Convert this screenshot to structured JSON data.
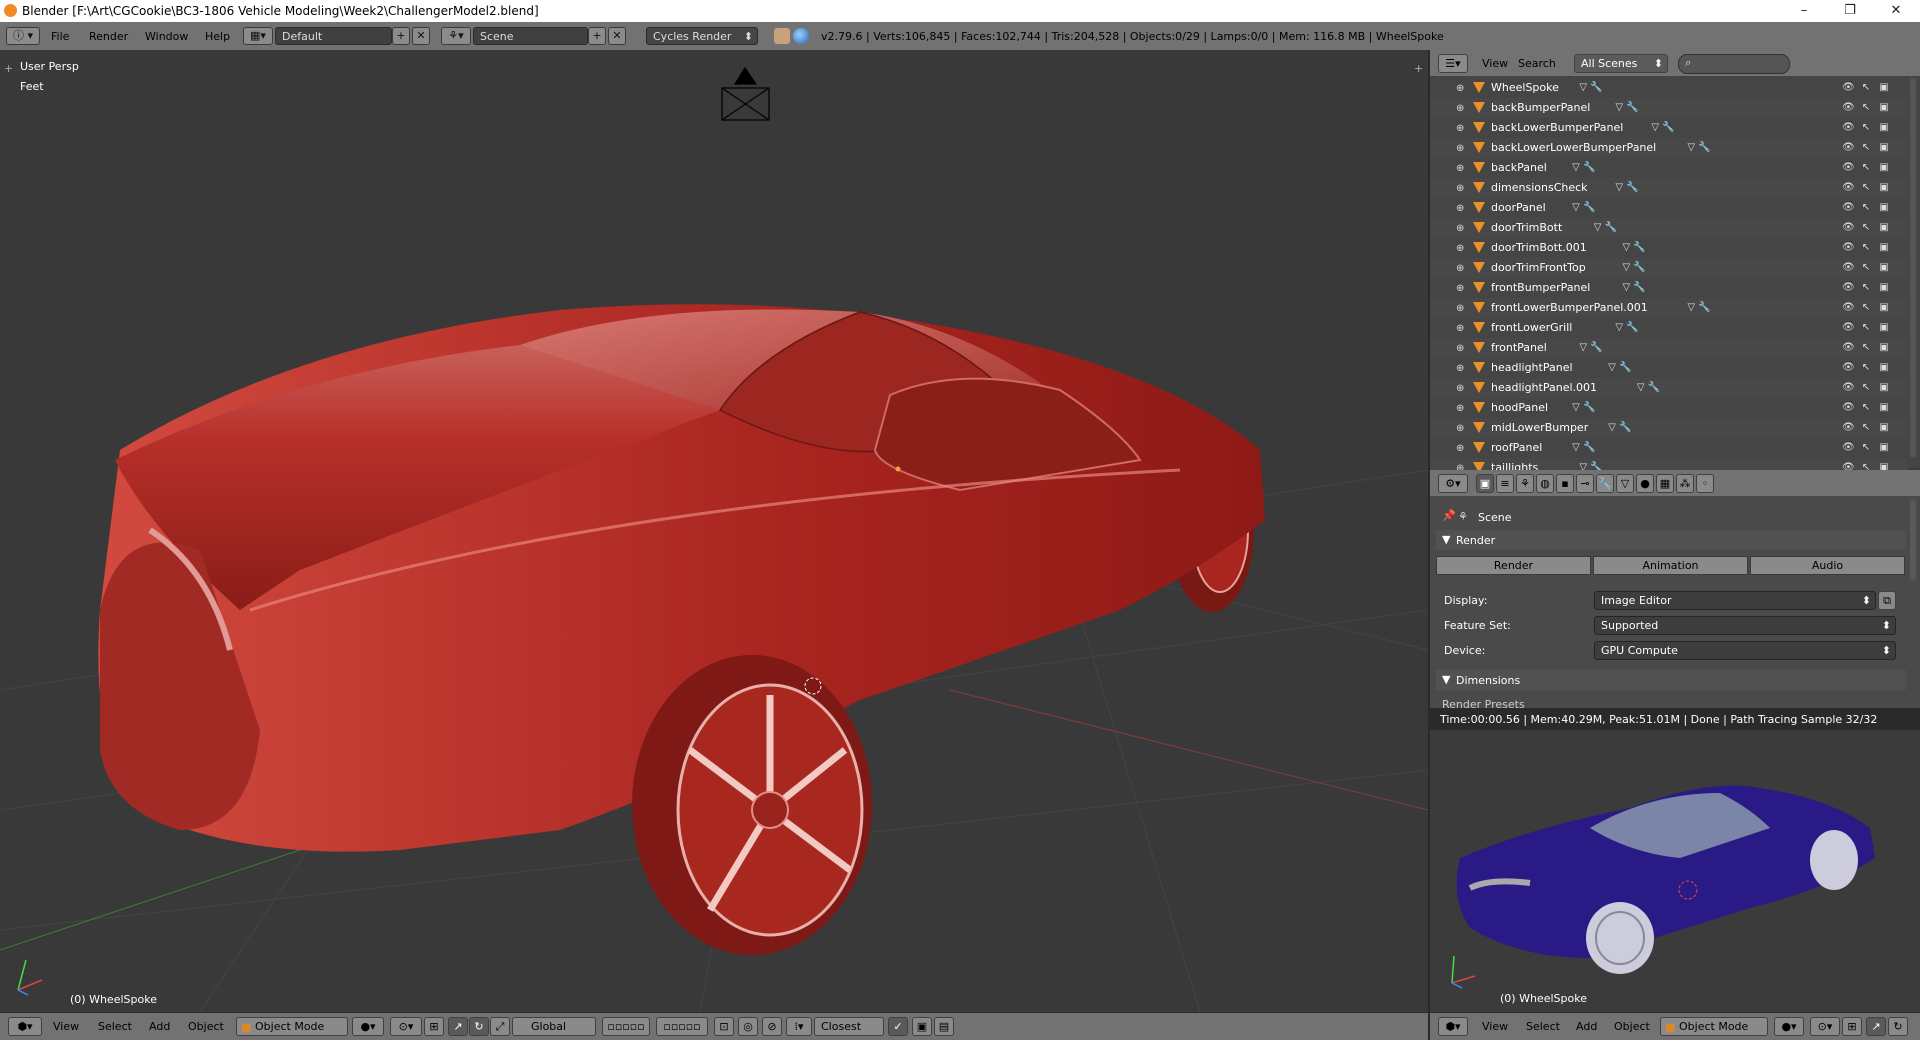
{
  "window": {
    "title": "Blender [F:\\Art\\CGCookie\\BC3-1806 Vehicle Modeling\\Week2\\ChallengerModel2.blend]",
    "controls": [
      "–",
      "❐",
      "✕"
    ]
  },
  "infobar": {
    "menus": [
      "File",
      "Render",
      "Window",
      "Help"
    ],
    "layout": "Default",
    "scene": "Scene",
    "engine": "Cycles Render",
    "stats": "v2.79.6 | Verts:106,845 | Faces:102,744 | Tris:204,528 | Objects:0/29 | Lamps:0/0 | Mem: 116.8 MB | WheelSpoke"
  },
  "viewport": {
    "view_name": "User Persp",
    "units": "Feet",
    "active_object": "(0) WheelSpoke",
    "car_color": "#a8241f"
  },
  "viewport_header": {
    "menus": [
      "View",
      "Select",
      "Add",
      "Object"
    ],
    "mode": "Object Mode",
    "orientation": "Global",
    "snap": "Closest"
  },
  "outliner": {
    "menus": [
      "View",
      "Search"
    ],
    "filter": "All Scenes",
    "search_placeholder": "",
    "items": [
      "WheelSpoke",
      "backBumperPanel",
      "backLowerBumperPanel",
      "backLowerLowerBumperPanel",
      "backPanel",
      "dimensionsCheck",
      "doorPanel",
      "doorTrimBott",
      "doorTrimBott.001",
      "doorTrimFrontTop",
      "frontBumperPanel",
      "frontLowerBumperPanel.001",
      "frontLowerGrill",
      "frontPanel",
      "headlightPanel",
      "headlightPanel.001",
      "hoodPanel",
      "midLowerBumper",
      "roofPanel",
      "taillights"
    ]
  },
  "properties": {
    "context": "Scene",
    "render_panel": "Render",
    "tabs": [
      "Render",
      "Animation",
      "Audio"
    ],
    "display_label": "Display:",
    "display_value": "Image Editor",
    "feature_label": "Feature Set:",
    "feature_value": "Supported",
    "device_label": "Device:",
    "device_value": "GPU Compute",
    "dimensions_panel": "Dimensions",
    "render_presets": "Render Presets"
  },
  "render_view": {
    "status": "Time:00:00.56 | Mem:40.29M, Peak:51.01M | Done | Path Tracing Sample 32/32",
    "active_object": "(0) WheelSpoke",
    "car_color": "#2a1a86"
  },
  "render_header": {
    "menus": [
      "View",
      "Select",
      "Add",
      "Object"
    ],
    "mode": "Object Mode"
  }
}
